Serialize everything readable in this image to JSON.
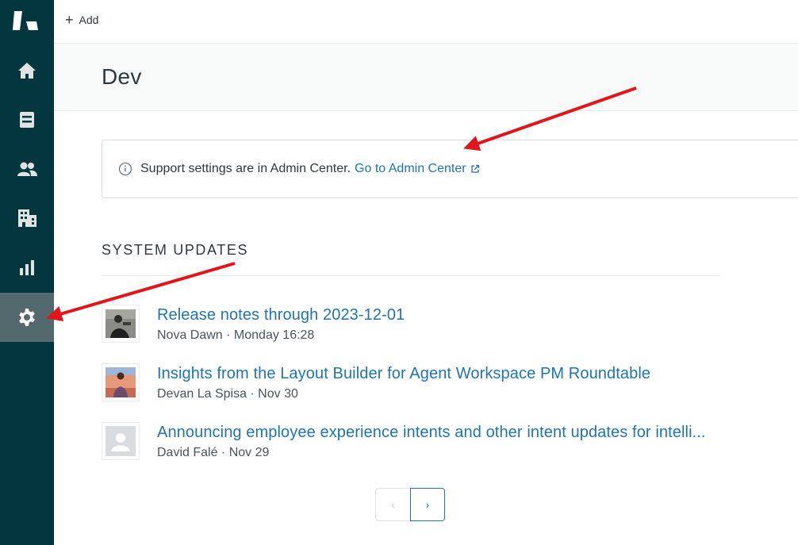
{
  "topbar": {
    "add_label": "Add"
  },
  "sidebar": {
    "items": [
      {
        "name": "home"
      },
      {
        "name": "views"
      },
      {
        "name": "customers"
      },
      {
        "name": "organizations"
      },
      {
        "name": "reporting"
      },
      {
        "name": "admin",
        "active": true
      }
    ]
  },
  "header": {
    "title": "Dev"
  },
  "notice": {
    "text": "Support settings are in Admin Center.",
    "link_label": "Go to Admin Center"
  },
  "system_updates": {
    "heading": "SYSTEM UPDATES",
    "items": [
      {
        "title": "Release notes through 2023-12-01",
        "meta": "Nova Dawn · Monday 16:28",
        "avatar": "photo-avatar"
      },
      {
        "title": "Insights from the Layout Builder for Agent Workspace PM Roundtable",
        "meta": "Devan La Spisa · Nov 30",
        "avatar": "photo-avatar"
      },
      {
        "title": "Announcing employee experience intents and other intent updates for intelli...",
        "meta": "David Falé · Nov 29",
        "avatar": "default-avatar"
      }
    ]
  },
  "pagination": {
    "prev": "‹",
    "next": "›"
  },
  "colors": {
    "sidebar": "#03363d",
    "sidebar_active": "#54696d",
    "link": "#1f73b7",
    "annotation_arrow": "#e0161b"
  }
}
